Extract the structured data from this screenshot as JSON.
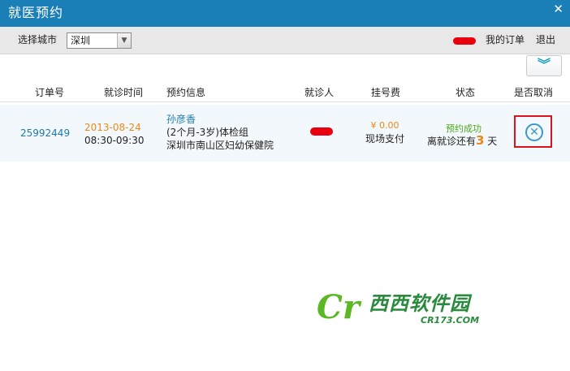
{
  "window": {
    "title": "就医预约",
    "close_icon": "close-icon",
    "title_bar_color": "#1a7fb6"
  },
  "toolbar": {
    "city_label": "选择城市",
    "city_value": "深圳",
    "my_orders": "我的订单",
    "logout": "退出"
  },
  "table": {
    "headers": [
      "订单号",
      "就诊时间",
      "预约信息",
      "就诊人",
      "挂号费",
      "状态",
      "是否取消"
    ],
    "rows": [
      {
        "order_id": "25992449",
        "date": "2013-08-24",
        "time": "08:30-09:30",
        "patient": "孙彦香",
        "desc": "(2个月-3岁)体检组",
        "hospital": "深圳市南山区妇幼保健院",
        "fee": "¥ 0.00",
        "payment": "现场支付",
        "status": "预约成功",
        "days_prefix": "离就诊还有",
        "days_num": "3",
        "days_suffix": "天"
      }
    ]
  },
  "watermark": {
    "logo": "Cr",
    "name": "西西软件园",
    "url": "CR173.COM"
  },
  "colors": {
    "link": "#1d7bb0",
    "accent": "#e88a1a",
    "success": "#4aa81a",
    "highlight_border": "#d8141e"
  }
}
